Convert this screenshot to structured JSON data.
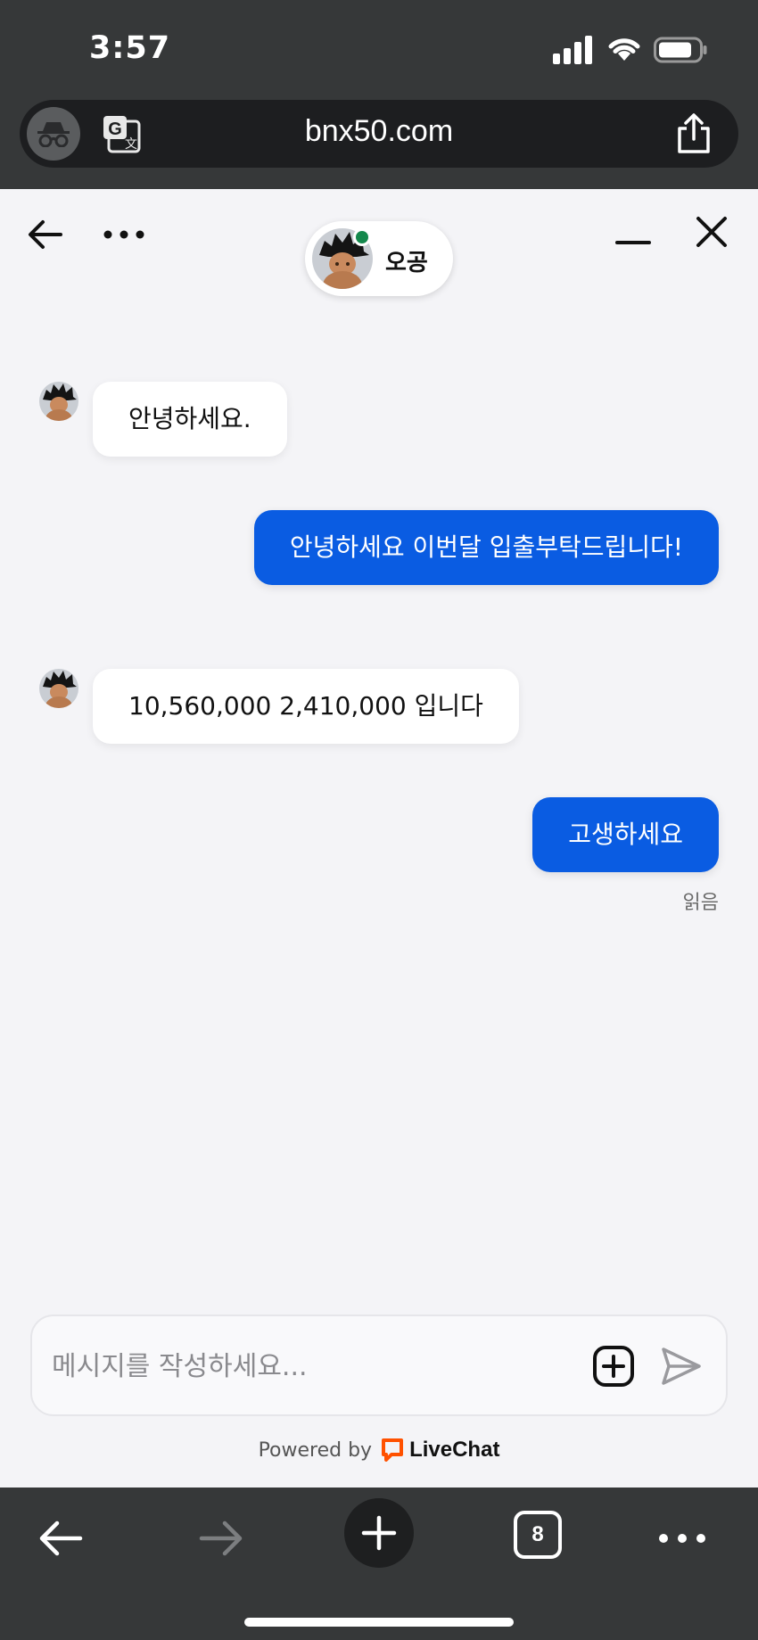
{
  "status_bar": {
    "time": "3:57"
  },
  "browser": {
    "url": "bnx50.com"
  },
  "chat": {
    "agent_name": "오공",
    "messages": [
      {
        "from": "agent",
        "text": "안녕하세요."
      },
      {
        "from": "visitor",
        "text": "안녕하세요 이번달 입출부탁드립니다!"
      },
      {
        "from": "agent",
        "text": "10,560,000 2,410,000 입니다"
      },
      {
        "from": "visitor",
        "text": "고생하세요"
      }
    ],
    "read_receipt": "읽음",
    "composer_placeholder": "메시지를 작성하세요...",
    "powered_by": "Powered by",
    "brand": "LiveChat"
  },
  "toolbar": {
    "tab_count": "8"
  },
  "colors": {
    "visitor_bubble": "#0a5ce2",
    "online": "#14884c",
    "brand_orange": "#ff5100",
    "chrome_dark": "#363839"
  }
}
